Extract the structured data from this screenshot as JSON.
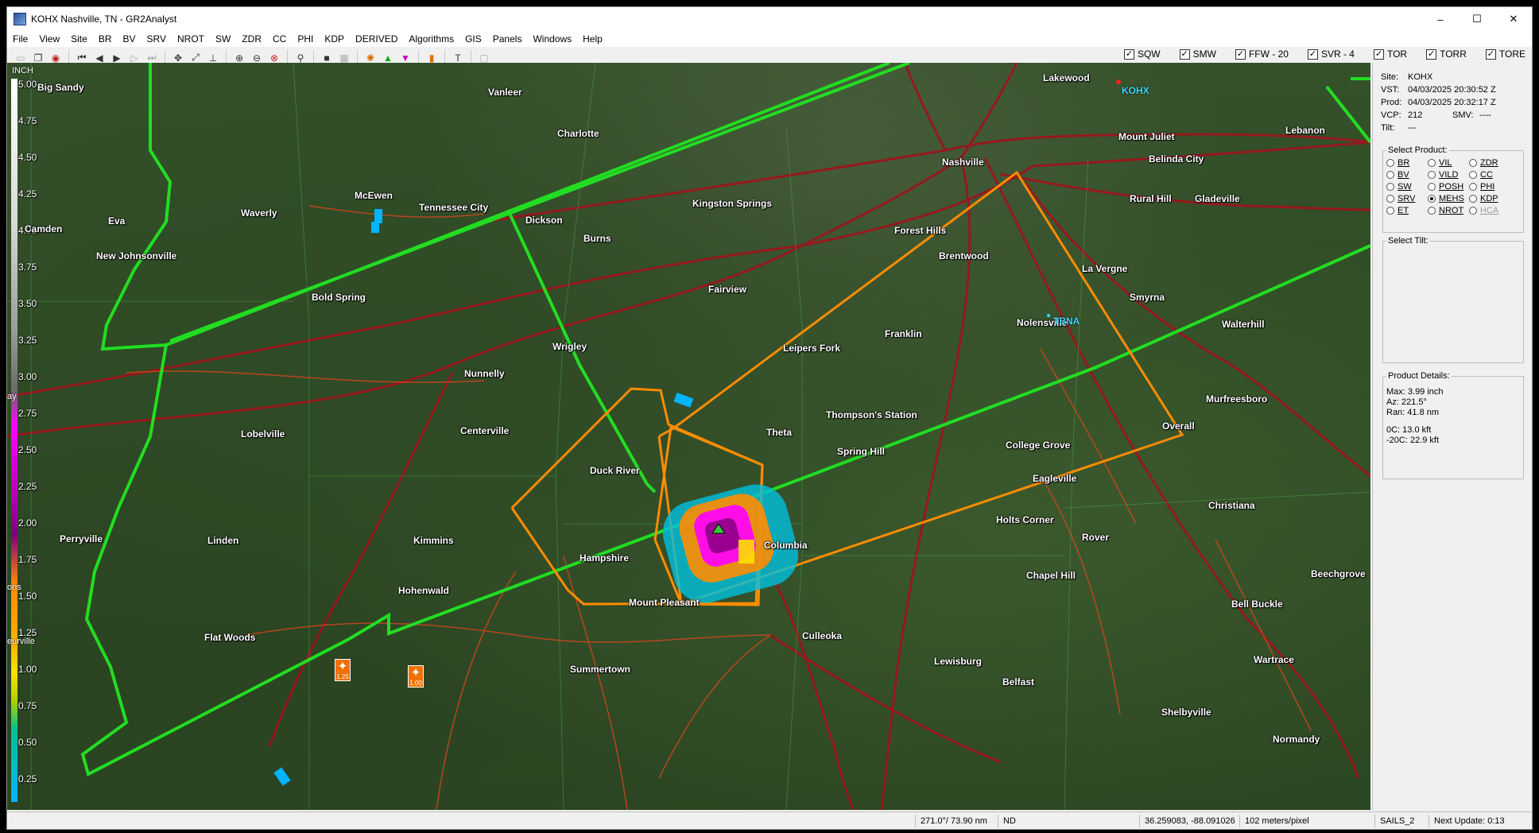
{
  "window": {
    "title": "KOHX Nashville, TN - GR2Analyst",
    "controls": [
      "–",
      "☐",
      "✕"
    ]
  },
  "menu": [
    "File",
    "View",
    "Site",
    "BR",
    "BV",
    "SRV",
    "NROT",
    "SW",
    "ZDR",
    "CC",
    "PHI",
    "KDP",
    "DERIVED",
    "Algorithms",
    "GIS",
    "Panels",
    "Windows",
    "Help"
  ],
  "warning_toggles": [
    {
      "label": "SQW",
      "checked": true
    },
    {
      "label": "SMW",
      "checked": true
    },
    {
      "label": "FFW - 20",
      "checked": true
    },
    {
      "label": "SVR - 4",
      "checked": true
    },
    {
      "label": "TOR",
      "checked": true
    },
    {
      "label": "TORR",
      "checked": true
    },
    {
      "label": "TORE",
      "checked": true
    }
  ],
  "colors": {
    "warning_svr": "#ff8c00",
    "warning_tor": "#22dd22",
    "roads": "#a0121c",
    "hail_accent": "#f07000"
  },
  "legend": {
    "unit": "INCH",
    "ticks": [
      "5.00",
      "4.75",
      "4.50",
      "4.25",
      "4.00",
      "3.75",
      "3.50",
      "3.25",
      "3.00",
      "2.75",
      "2.50",
      "2.25",
      "2.00",
      "1.75",
      "1.50",
      "1.25",
      "1.00",
      "0.75",
      "0.50",
      "0.25"
    ],
    "side_labels": [
      "ay",
      "ons",
      "eurville"
    ]
  },
  "towns": [
    "Big Sandy",
    "Vanleer",
    "Charlotte",
    "McEwen",
    "Tennessee City",
    "Waverly",
    "Dickson",
    "Kingston Springs",
    "Camden",
    "Eva",
    "New Johnsonville",
    "Burns",
    "Bold Spring",
    "Fairview",
    "Wrigley",
    "Nunnelly",
    "Centerville",
    "Lobelville",
    "Duck River",
    "Theta",
    "Leipers Fork",
    "Thompson's Station",
    "Spring Hill",
    "Perryville",
    "Linden",
    "Kimmins",
    "Hampshire",
    "Columbia",
    "Hohenwald",
    "Mount Pleasant",
    "Flat Woods",
    "Culleoka",
    "Summertown",
    "Lewisburg",
    "Belfast",
    "Nashville",
    "Lakewood",
    "Mount Juliet",
    "Lebanon",
    "Belinda City",
    "Rural Hill",
    "Gladeville",
    "Forest Hills",
    "Brentwood",
    "La Vergne",
    "Smyrna",
    "Nolensville",
    "Franklin",
    "Walterhill",
    "Murfreesboro",
    "Overall",
    "College Grove",
    "Eagleville",
    "Christiana",
    "Holts Corner",
    "Rover",
    "Chapel Hill",
    "Beechgrove",
    "Bell Buckle",
    "Wartrace",
    "Shelbyville",
    "Normandy"
  ],
  "stations": [
    "KOHX",
    "TBNA"
  ],
  "hail_markers": [
    {
      "size": "1.25"
    },
    {
      "size": "1.00"
    }
  ],
  "panel": {
    "site_label": "Site:",
    "site": "KOHX",
    "vst_label": "VST:",
    "vst": "04/03/2025  20:30:52 Z",
    "prod_label": "Prod:",
    "prod": "04/03/2025  20:32:17 Z",
    "vcp_label": "VCP:",
    "vcp": "212",
    "smv_label": "SMV:",
    "smv": "----",
    "tilt_label": "Tilt:",
    "tilt": "---",
    "select_product_title": "Select Product:",
    "products": [
      {
        "label": "BR",
        "selected": false,
        "enabled": true
      },
      {
        "label": "VIL",
        "selected": false,
        "enabled": true
      },
      {
        "label": "ZDR",
        "selected": false,
        "enabled": true
      },
      {
        "label": "BV",
        "selected": false,
        "enabled": true
      },
      {
        "label": "VILD",
        "selected": false,
        "enabled": true
      },
      {
        "label": "CC",
        "selected": false,
        "enabled": true
      },
      {
        "label": "SW",
        "selected": false,
        "enabled": true
      },
      {
        "label": "POSH",
        "selected": false,
        "enabled": true
      },
      {
        "label": "PHI",
        "selected": false,
        "enabled": true
      },
      {
        "label": "SRV",
        "selected": false,
        "enabled": true
      },
      {
        "label": "MEHS",
        "selected": true,
        "enabled": true
      },
      {
        "label": "KDP",
        "selected": false,
        "enabled": true
      },
      {
        "label": "ET",
        "selected": false,
        "enabled": true
      },
      {
        "label": "NROT",
        "selected": false,
        "enabled": true
      },
      {
        "label": "HCA",
        "selected": false,
        "enabled": false
      }
    ],
    "select_tilt_title": "Select Tilt:",
    "product_details_title": "Product Details:",
    "details": [
      "Max:  3.99 inch",
      "Az:  221.5°",
      "Ran:  41.8 nm",
      "",
      " 0C: 13.0 kft",
      "-20C: 22.9 kft"
    ]
  },
  "status": {
    "az_range": "271.0°/ 73.90 nm",
    "value": "ND",
    "latlon": "36.259083, -88.091026",
    "scale": "102 meters/pixel",
    "mode": "SAILS_2",
    "next_update": "Next Update: 0:13"
  }
}
